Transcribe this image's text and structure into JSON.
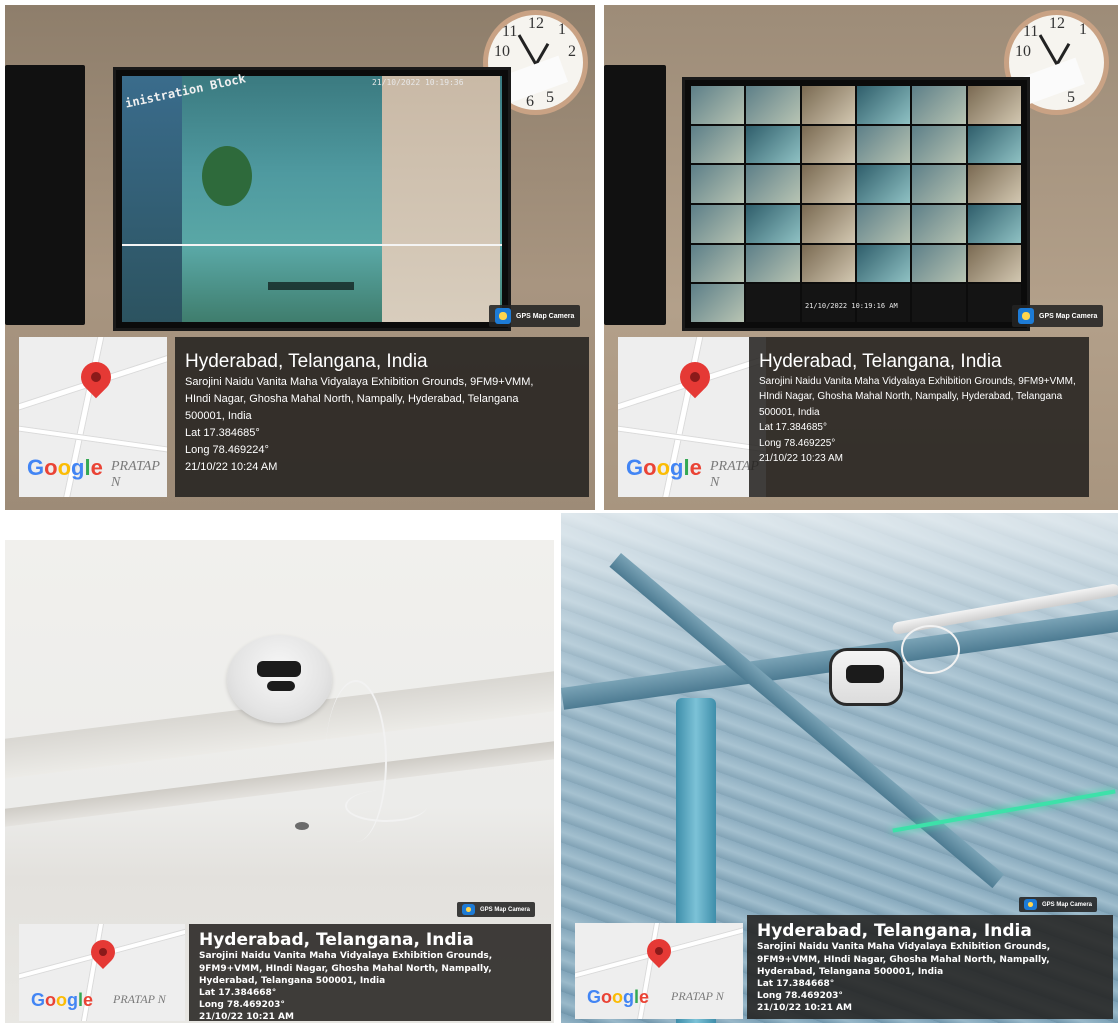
{
  "photos": [
    {
      "badge": "GPS Map Camera",
      "map_brand": "Google",
      "watermark": "PRATAP N",
      "osd_time": "21/10/2022 10:19:36",
      "osd_sign": "inistration Block",
      "info": {
        "city": "Hyderabad, Telangana, India",
        "address_1": "Sarojini Naidu Vanita Maha Vidyalaya Exhibition Grounds, 9FM9+VMM,",
        "address_2": "HIndi Nagar, Ghosha Mahal North, Nampally, Hyderabad, Telangana",
        "address_3": "500001, India",
        "lat": "Lat 17.384685°",
        "long": "Long 78.469224°",
        "datetime": "21/10/22 10:24 AM"
      }
    },
    {
      "badge": "GPS Map Camera",
      "map_brand": "Google",
      "watermark": "PRATAP N",
      "osd_time": "21/10/2022 10:19:16 AM",
      "info": {
        "city": "Hyderabad, Telangana, India",
        "address_1": "Sarojini Naidu Vanita Maha Vidyalaya Exhibition Grounds, 9FM9+VMM,",
        "address_2": "HIndi Nagar, Ghosha Mahal North, Nampally, Hyderabad, Telangana",
        "address_3": "500001, India",
        "lat": "Lat 17.384685°",
        "long": "Long 78.469225°",
        "datetime": "21/10/22 10:23 AM"
      }
    },
    {
      "badge": "GPS Map Camera",
      "map_brand": "Google",
      "watermark": "PRATAP N",
      "info": {
        "city": "Hyderabad, Telangana, India",
        "address_1": "Sarojini Naidu Vanita Maha Vidyalaya Exhibition Grounds,",
        "address_2": "9FM9+VMM, HIndi Nagar, Ghosha Mahal North, Nampally,",
        "address_3": "Hyderabad, Telangana 500001, India",
        "lat": "Lat 17.384668°",
        "long": "Long 78.469203°",
        "datetime": "21/10/22 10:21 AM"
      }
    },
    {
      "badge": "GPS Map Camera",
      "map_brand": "Google",
      "watermark": "PRATAP N",
      "info": {
        "city": "Hyderabad, Telangana, India",
        "address_1": "Sarojini Naidu Vanita Maha Vidyalaya Exhibition Grounds,",
        "address_2": "9FM9+VMM, HIndi Nagar, Ghosha Mahal North, Nampally,",
        "address_3": "Hyderabad, Telangana 500001, India",
        "lat": "Lat 17.384668°",
        "long": "Long 78.469203°",
        "datetime": "21/10/22 10:21 AM"
      }
    }
  ],
  "clock_numbers": [
    "11",
    "12",
    "1",
    "2",
    "10",
    "5",
    "6"
  ],
  "colors": {
    "pin": "#e53935",
    "info_bg": "#22201d",
    "google_blue": "#4285F4",
    "google_red": "#EA4335",
    "google_yellow": "#FBBC05",
    "google_green": "#34A853"
  }
}
